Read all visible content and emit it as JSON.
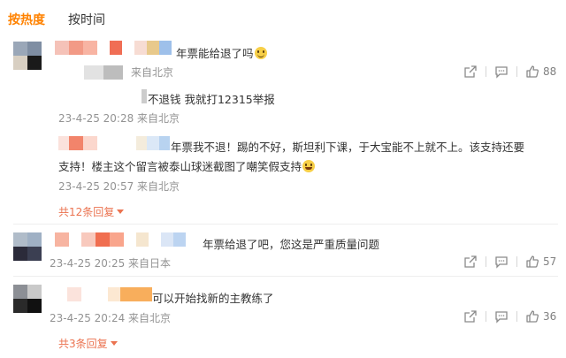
{
  "tabs": [
    {
      "label": "按热度",
      "active": true
    },
    {
      "label": "按时间",
      "active": false
    }
  ],
  "comments": [
    {
      "text": "年票能给退了吗",
      "source": "来自北京",
      "likes": "88",
      "replies": [
        {
          "text": "不退钱 我就打12315举报",
          "meta": "23-4-25 20:28 来自北京"
        },
        {
          "text_line1": "年票我不退！踢的不好，斯坦利下课，于大宝能不上就不上。该支持还要",
          "text_line2": "支持！楼主这个留言被泰山球迷截图了嘲笑假支持",
          "meta": "23-4-25 20:57 来自北京"
        }
      ],
      "more_replies": "共12条回复"
    },
    {
      "text": "年票给退了吧，您这是严重质量问题",
      "meta": "23-4-25 20:25 来自日本",
      "likes": "57"
    },
    {
      "text": "可以开始找新的主教练了",
      "meta": "23-4-25 20:24 来自北京",
      "likes": "36",
      "more_replies": "共3条回复"
    }
  ],
  "colors": {
    "accent": "#ff8200",
    "reply_link": "#eb7350",
    "meta_gray": "#939393"
  },
  "icons": [
    "share-icon",
    "comment-icon",
    "like-icon"
  ]
}
